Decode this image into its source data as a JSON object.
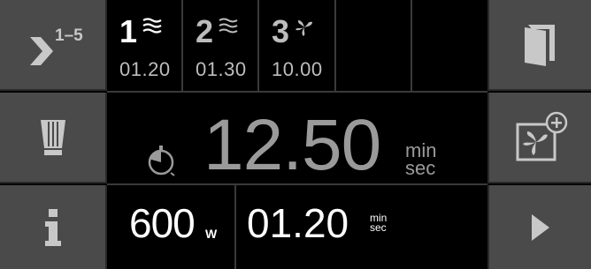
{
  "sidebar_left": {
    "steps_button": {
      "label": "1–5",
      "icon": "chevron-right-icon"
    },
    "chef_hat_button": {
      "icon": "chef-hat-icon"
    },
    "info_button": {
      "icon": "info-icon"
    }
  },
  "sidebar_right": {
    "door_button": {
      "icon": "door-icon"
    },
    "add_fan_button": {
      "icon": "fan-add-icon"
    },
    "play_button": {
      "icon": "play-icon"
    }
  },
  "steps": [
    {
      "number": "1",
      "mode_icon": "microwave-waves-icon",
      "time": "01.20",
      "active": true
    },
    {
      "number": "2",
      "mode_icon": "microwave-waves-icon",
      "time": "01.30",
      "active": false
    },
    {
      "number": "3",
      "mode_icon": "fan-icon",
      "time": "10.00",
      "active": false
    },
    {
      "number": "",
      "mode_icon": "",
      "time": "",
      "active": false
    },
    {
      "number": "",
      "mode_icon": "",
      "time": "",
      "active": false
    }
  ],
  "main": {
    "timer_icon": "timer-icon",
    "total_time": "12.50",
    "unit_top": "min",
    "unit_bottom": "sec"
  },
  "bottom": {
    "power_value": "600",
    "power_unit": "W",
    "step_time": "01.20",
    "unit_top": "min",
    "unit_bottom": "sec"
  },
  "colors": {
    "background": "#000000",
    "side_button": "#4a4a4a",
    "active_text": "#ffffff",
    "dim_text": "#bdbdbd",
    "main_time": "#9a9a9a"
  }
}
